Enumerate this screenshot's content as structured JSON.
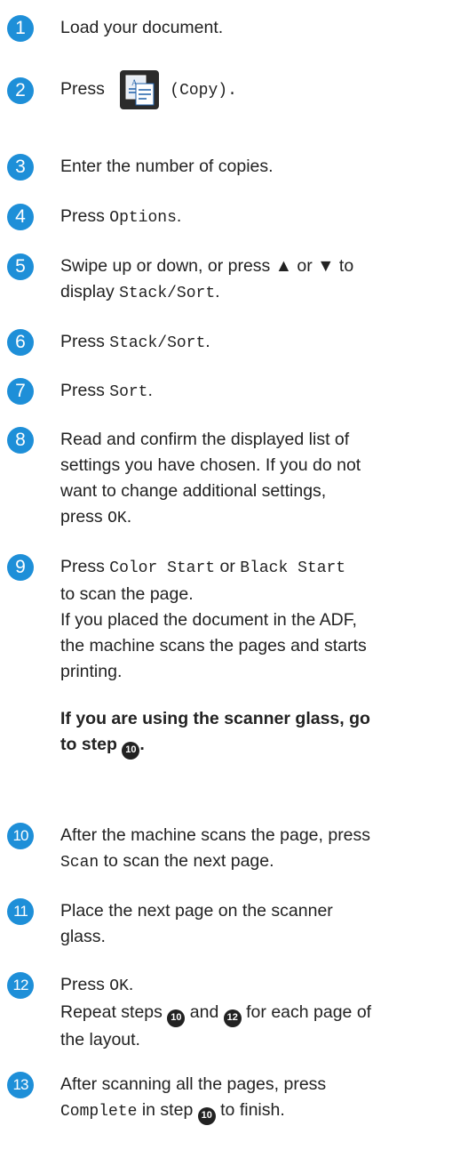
{
  "steps": [
    {
      "n": "1",
      "text": "Load your document."
    },
    {
      "n": "2",
      "pre": "Press",
      "post": "(Copy)."
    },
    {
      "n": "3",
      "text": "Enter the number of copies."
    },
    {
      "n": "4",
      "pre": "Press ",
      "ui": "Options",
      "post": "."
    },
    {
      "n": "5",
      "line1": "Swipe up or down, or press ▲ or ▼ to",
      "line2_pre": "display ",
      "ui": "Stack/Sort",
      "post": "."
    },
    {
      "n": "6",
      "pre": "Press ",
      "ui": "Stack/Sort",
      "post": "."
    },
    {
      "n": "7",
      "pre": "Press ",
      "ui": "Sort",
      "post": "."
    },
    {
      "n": "8",
      "line1": "Read and confirm the displayed list of",
      "line2": "settings you have chosen. If you do not",
      "line3": "want to change additional settings,",
      "line4_pre": "press ",
      "ui": "OK",
      "post": "."
    },
    {
      "n": "9",
      "pre": "Press ",
      "ui1": "Color Start",
      "mid": " or ",
      "ui2": "Black Start",
      "line2": "to scan the page.",
      "line3": "If you placed the document in the ADF,",
      "line4": "the machine scans the pages and starts",
      "line5": "printing.",
      "note1": "If you are using the scanner glass, go",
      "note2": "to step",
      "note_ref": "10",
      "note_end": "."
    },
    {
      "n": "10",
      "line1": "After the machine scans the page, press",
      "ui": "Scan",
      "post": " to scan the next page."
    },
    {
      "n": "11",
      "line1": "Place the next page on the scanner",
      "line2": "glass."
    },
    {
      "n": "12",
      "pre": "Press ",
      "ui": "OK",
      "post": ".",
      "line2_pre": "Repeat steps",
      "ref1": "10",
      "and": "and",
      "ref2": "12",
      "line2_post": "for each page of",
      "line3": "the layout."
    },
    {
      "n": "13",
      "line1": "After scanning all the pages, press",
      "ui": "Complete",
      "mid": " in step",
      "ref": "10",
      "post": " to finish."
    }
  ]
}
